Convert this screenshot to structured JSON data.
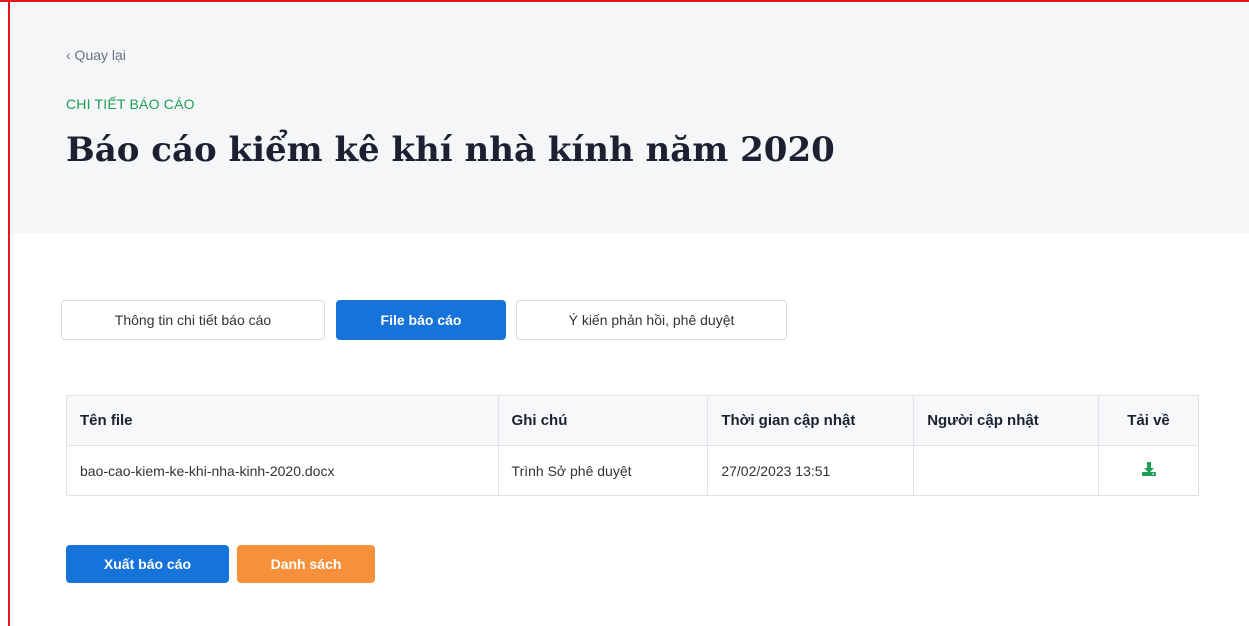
{
  "header": {
    "back_link": "‹ Quay lại",
    "section_label": "CHI TIẾT BÁO CÁO",
    "title": "Báo cáo kiểm kê khí nhà kính năm 2020"
  },
  "tabs": [
    {
      "label": "Thông tin chi tiết báo cáo",
      "active": false
    },
    {
      "label": "File báo cáo",
      "active": true
    },
    {
      "label": "Ý kiến phản hồi, phê duyệt",
      "active": false
    }
  ],
  "table": {
    "columns": [
      "Tên file",
      "Ghi chú",
      "Thời gian cập nhật",
      "Người cập nhật",
      "Tải về"
    ],
    "rows": [
      {
        "file_name": "bao-cao-kiem-ke-khi-nha-kinh-2020.docx",
        "note": "Trình Sở phê duyệt",
        "updated_at": "27/02/2023 13:51",
        "updated_by": "",
        "download_icon": "download-icon"
      }
    ]
  },
  "actions": {
    "export_label": "Xuất báo cáo",
    "list_label": "Danh sách"
  },
  "colors": {
    "primary": "#1573d9",
    "secondary": "#f7903a",
    "accent_green": "#1f9d55",
    "header_bg": "#f5f6f8",
    "frame": "#e3161b"
  }
}
